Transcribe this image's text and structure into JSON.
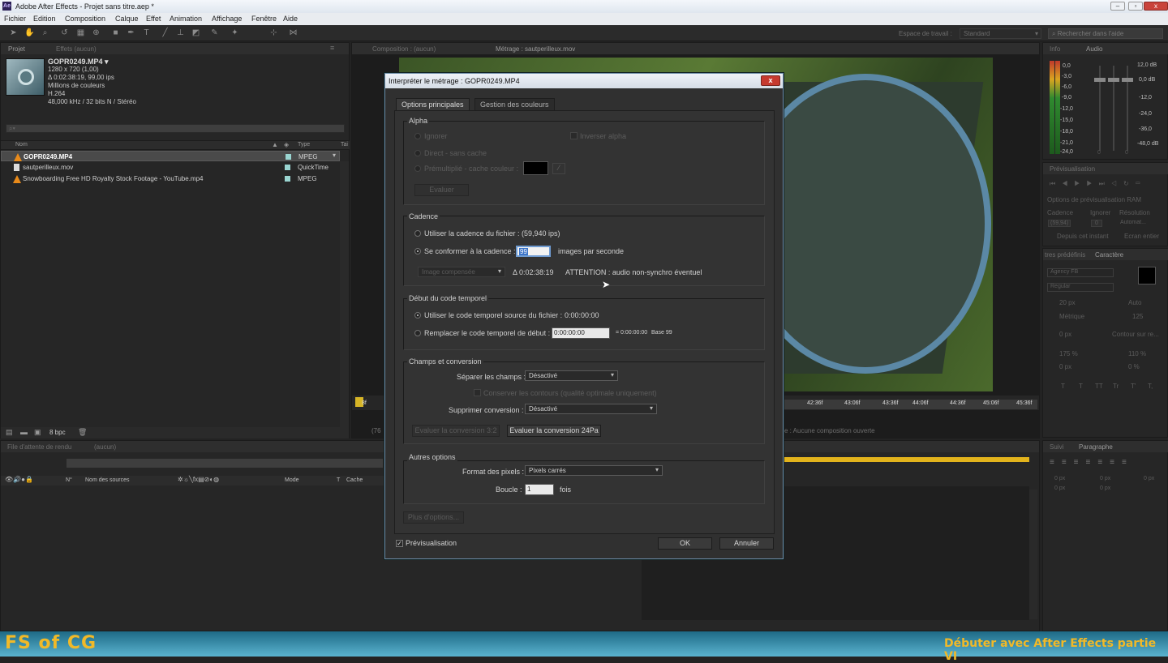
{
  "window": {
    "title": "Adobe After Effects - Projet sans titre.aep *",
    "app_badge": "Ae"
  },
  "menu": [
    "Fichier",
    "Edition",
    "Composition",
    "Calque",
    "Effet",
    "Animation",
    "Affichage",
    "Fenêtre",
    "Aide"
  ],
  "toolbar": {
    "workspace_label": "Espace de travail :",
    "workspace_value": "Standard",
    "help_placeholder": "Rechercher dans l'aide"
  },
  "project_panel": {
    "tabs": [
      "Projet",
      "Effets (aucun)"
    ],
    "footage": {
      "name": "GOPR0249.MP4 ▾",
      "dims": "1280 x 720 (1,00)",
      "duration": "Δ 0:02:38:19, 99,00 ips",
      "colors": "Millions de couleurs",
      "codec": "H.264",
      "audio": "48,000 kHz / 32 bits N / Stéréo"
    },
    "columns": {
      "name": "Nom",
      "type": "Type",
      "size": "Tai"
    },
    "items": [
      {
        "name": "GOPR0249.MP4",
        "type": "MPEG"
      },
      {
        "name": "sautperilleux.mov",
        "type": "QuickTime"
      },
      {
        "name": "Snowboarding Free HD Royalty Stock Footage - YouTube.mp4",
        "type": "MPEG"
      }
    ],
    "bpc": "8 bpc"
  },
  "viewer": {
    "tabs": [
      "Composition : (aucun)",
      "Métrage : sautperilleux.mov"
    ],
    "ruler": [
      "42:36f",
      "43:06f",
      "43:36f",
      "44:06f",
      "44:36f",
      "45:06f",
      "45:36f"
    ],
    "ruler_left": "8f",
    "status": "e : Aucune composition ouverte",
    "zoom_left": "(76"
  },
  "info_panel": {
    "tabs": [
      "Info",
      "Audio"
    ],
    "db_left": [
      "0,0",
      "-3,0",
      "-6,0",
      "-9,0",
      "-12,0",
      "-15,0",
      "-18,0",
      "-21,0",
      "-24,0"
    ],
    "db_right": [
      "12,0 dB",
      "0,0 dB",
      "-12,0",
      "-24,0",
      "-36,0",
      "-48,0 dB"
    ],
    "slider_zero": "0"
  },
  "preview_panel": {
    "tab": "Prévisualisation",
    "ram": "Options de prévisualisation RAM",
    "cadence": "Cadence",
    "ignorer": "Ignorer",
    "resolution": "Résolution",
    "cad_val": "(59,94)",
    "ign_val": "0",
    "res_val": "Automat...",
    "depuis": "Depuis cet instant",
    "ecran": "Ecran entier"
  },
  "char_panel": {
    "tabs": [
      "tres prédéfinis",
      "Caractère"
    ],
    "font": "Agency FB",
    "style": "Regular",
    "size": "20 px",
    "leading": "Auto",
    "kern": "Métrique",
    "track": "125",
    "stroke": "0 px",
    "stroke_mode": "Contour sur re...",
    "vscale": "175 %",
    "hscale": "110 %",
    "baseline": "0 px",
    "tsume": "0 %",
    "styles": [
      "T",
      "T",
      "TT",
      "Tr",
      "T'",
      "T,"
    ]
  },
  "para_panel": {
    "tabs": [
      "Suivi",
      "Paragraphe"
    ],
    "vals": [
      "0 px",
      "0 px",
      "0 px",
      "0 px",
      "0 px"
    ]
  },
  "render_panel": {
    "tabs": [
      "File d'attente de rendu",
      "(aucun)"
    ],
    "cols": [
      "N°",
      "Nom des sources",
      "Mode",
      "T",
      "Cache"
    ]
  },
  "dialog": {
    "title": "Interpréter le métrage : GOPR0249.MP4",
    "close": "x",
    "tabs": [
      "Options principales",
      "Gestion des couleurs"
    ],
    "alpha": {
      "legend": "Alpha",
      "ignore": "Ignorer",
      "invert": "Inverser alpha",
      "direct": "Direct - sans cache",
      "premult": "Prémultiplié - cache couleur :",
      "evaluate": "Evaluer"
    },
    "cadence": {
      "legend": "Cadence",
      "use_file": "Utiliser la cadence du fichier :",
      "file_rate": "(59,940 ips)",
      "conform": "Se conformer à la cadence :",
      "conform_value": "99",
      "fps": "images par seconde",
      "blend": "Image compensée",
      "duration": "Δ 0:02:38:19",
      "warning": "ATTENTION : audio non-synchro éventuel"
    },
    "timecode": {
      "legend": "Début du code temporel",
      "use_source": "Utiliser le code temporel source du fichier :",
      "source_value": "0:00:00:00",
      "replace": "Remplacer le code temporel de début :",
      "replace_value": "0:00:00:00",
      "eq": "= 0:00:00:00",
      "base": "Base 99"
    },
    "fields": {
      "legend": "Champs et conversion",
      "separate": "Séparer les champs :",
      "separate_value": "Désactivé",
      "preserve": "Conserver les contours (qualité optimale uniquement)",
      "remove": "Supprimer conversion :",
      "remove_value": "Désactivé",
      "eval32": "Evaluer la conversion 3:2",
      "eval24": "Evaluer la conversion 24Pa"
    },
    "other": {
      "legend": "Autres options",
      "pixel": "Format des pixels :",
      "pixel_value": "Pixels carrés",
      "loop": "Boucle :",
      "loop_value": "1",
      "times": "fois"
    },
    "more": "Plus d'options...",
    "preview": "Prévisualisation",
    "ok": "OK",
    "cancel": "Annuler"
  },
  "footer": {
    "logo": "FS of CG",
    "caption": "Débuter avec After Effects partie VI"
  }
}
